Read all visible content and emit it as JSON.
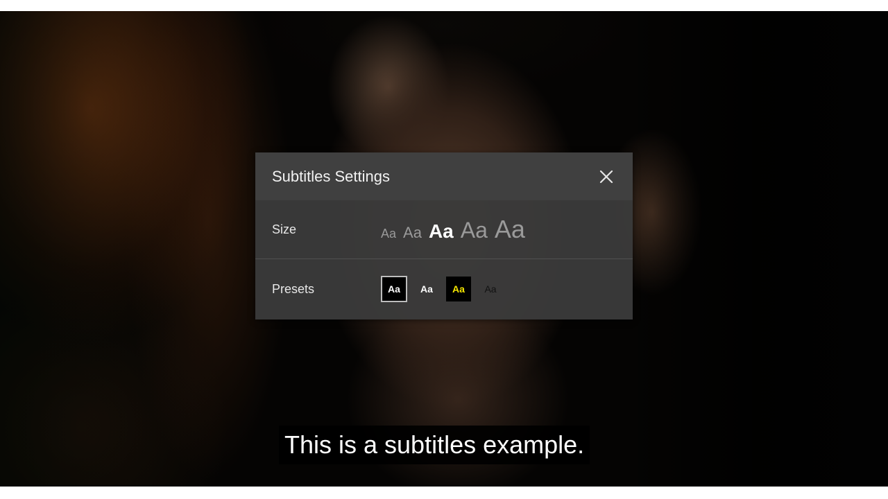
{
  "dialog": {
    "title": "Subtitles Settings",
    "close_icon": "close-icon"
  },
  "size": {
    "label": "Size",
    "options": [
      "Aa",
      "Aa",
      "Aa",
      "Aa",
      "Aa"
    ],
    "selected_index": 2
  },
  "presets": {
    "label": "Presets",
    "options": [
      "Aa",
      "Aa",
      "Aa",
      "Aa"
    ],
    "selected_index": 0,
    "colors": {
      "preset_1_text": "#ffffff",
      "preset_1_background": "#000000",
      "preset_2_text": "#ffffff",
      "preset_3_text": "#f5e600",
      "preset_3_background": "#000000",
      "preset_4_text": "#111111"
    }
  },
  "subtitle": {
    "text": "This is a subtitles example."
  }
}
